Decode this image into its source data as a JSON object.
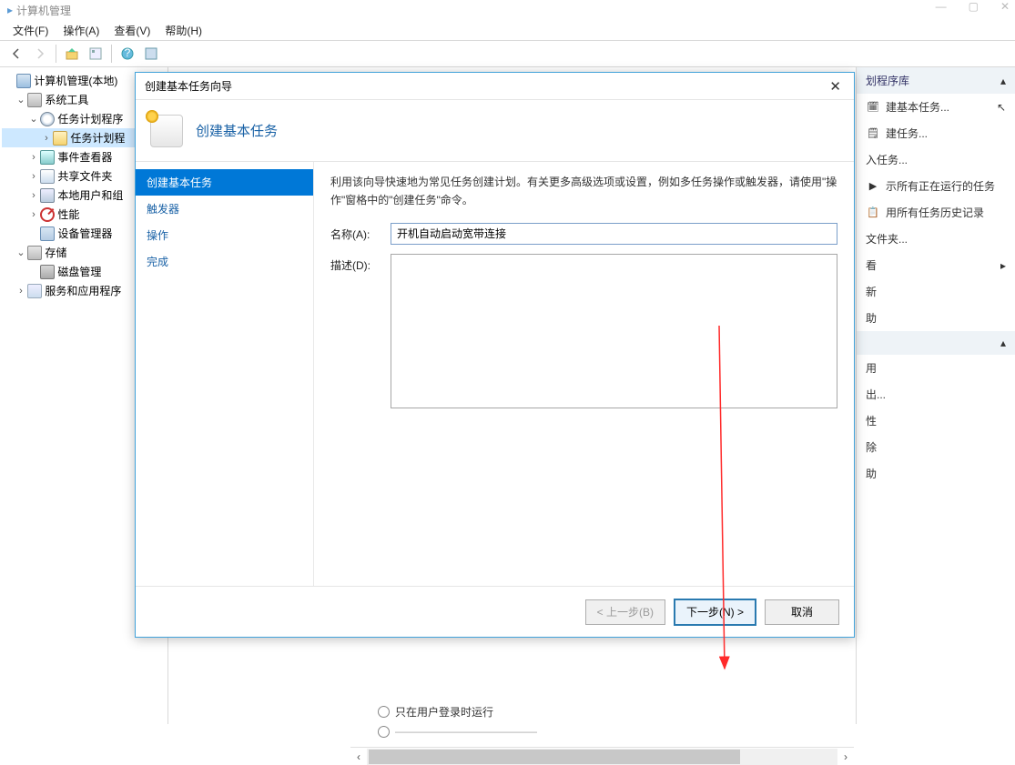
{
  "window": {
    "title": "计算机管理"
  },
  "menu": {
    "file": "文件(F)",
    "action": "操作(A)",
    "view": "查看(V)",
    "help": "帮助(H)"
  },
  "tree": {
    "root": "计算机管理(本地)",
    "system_tools": "系统工具",
    "task_scheduler": "任务计划程序",
    "task_scheduler_library": "任务计划程",
    "event_viewer": "事件查看器",
    "shared_folders": "共享文件夹",
    "local_users": "本地用户和组",
    "performance": "性能",
    "device_manager": "设备管理器",
    "storage": "存储",
    "disk_management": "磁盘管理",
    "services_apps": "服务和应用程序"
  },
  "right_pane": {
    "header1": "划程序库",
    "create_basic": "建基本任务...",
    "create_task": "建任务...",
    "import_task": "入任务...",
    "show_running": "示所有正在运行的任务",
    "history": "用所有任务历史记录",
    "folder": "文件夹...",
    "view": "看",
    "refresh": "新",
    "help": "助",
    "section2_header": "",
    "enable": "用",
    "export": "出...",
    "properties": "性",
    "delete": "除",
    "help2": "助"
  },
  "bottom": {
    "radio_label": "只在用户登录时运行"
  },
  "dialog": {
    "title": "创建基本任务向导",
    "banner_title": "创建基本任务",
    "nav": {
      "create_basic": "创建基本任务",
      "trigger": "触发器",
      "action": "操作",
      "finish": "完成"
    },
    "description": "利用该向导快速地为常见任务创建计划。有关更多高级选项或设置，例如多任务操作或触发器，请使用\"操作\"窗格中的\"创建任务\"命令。",
    "name_label": "名称(A):",
    "name_value": "开机自动启动宽带连接",
    "desc_label": "描述(D):",
    "desc_value": "",
    "back": "< 上一步(B)",
    "next": "下一步(N) >",
    "cancel": "取消"
  }
}
